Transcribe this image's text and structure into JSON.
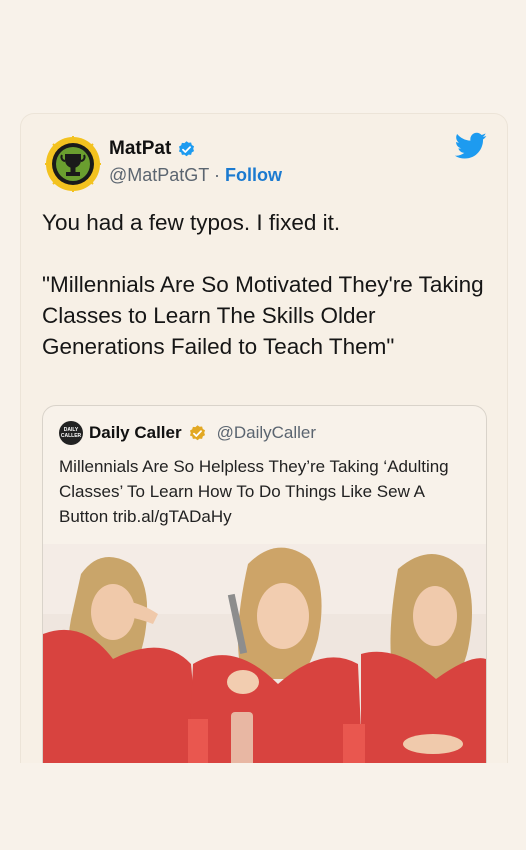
{
  "tweet": {
    "author_name": "MatPat",
    "author_handle": "@MatPatGT",
    "separator": "·",
    "follow_label": "Follow",
    "text_line1": "You had a few typos. I fixed it.",
    "text_line2": "\"Millennials Are So Motivated They're Taking Classes to Learn The Skills Older Generations Failed to Teach Them\""
  },
  "quote": {
    "logo_text_top": "DAILY",
    "logo_text_bottom": "CALLER",
    "author_name": "Daily Caller",
    "author_handle": "@DailyCaller",
    "text": "Millennials Are So Helpless They’re Taking ‘Adulting Classes’ To Learn How To Do Things Like Sew A Button trib.al/gTADaHy"
  },
  "colors": {
    "background": "#f8f2ea",
    "twitter_blue": "#1d9bf0",
    "verified_blue": "#1d9bf0",
    "verified_gold": "#e2a823",
    "follow_link": "#1b7ad0",
    "shirt_red": "#d8433f"
  },
  "icons": {
    "twitter": "twitter-bird-icon",
    "verified": "verified-badge-icon",
    "gold_verified": "gold-verified-badge-icon"
  }
}
